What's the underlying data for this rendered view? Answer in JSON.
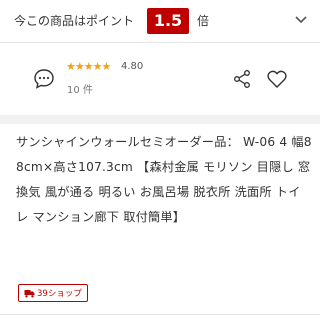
{
  "banner": {
    "text": "今この商品はポイント",
    "multiplier": "1.5",
    "suffix": "倍"
  },
  "review": {
    "stars": "★★★★★",
    "rating": "4.80",
    "count": "10 件"
  },
  "product": {
    "title": "サンシャインウォールセミオーダー品： W-06 4 幅88cm×高さ107.3cm 【森村金属 モリソン 目隠し 窓 換気 風が通る 明るい お風呂場 脱衣所 洗面所 トイレ マンション廊下 取付簡単】"
  },
  "shop_tag": {
    "label": "39ショップ"
  },
  "colors": {
    "accent": "#bf0000",
    "stars": "#f0a21a"
  }
}
